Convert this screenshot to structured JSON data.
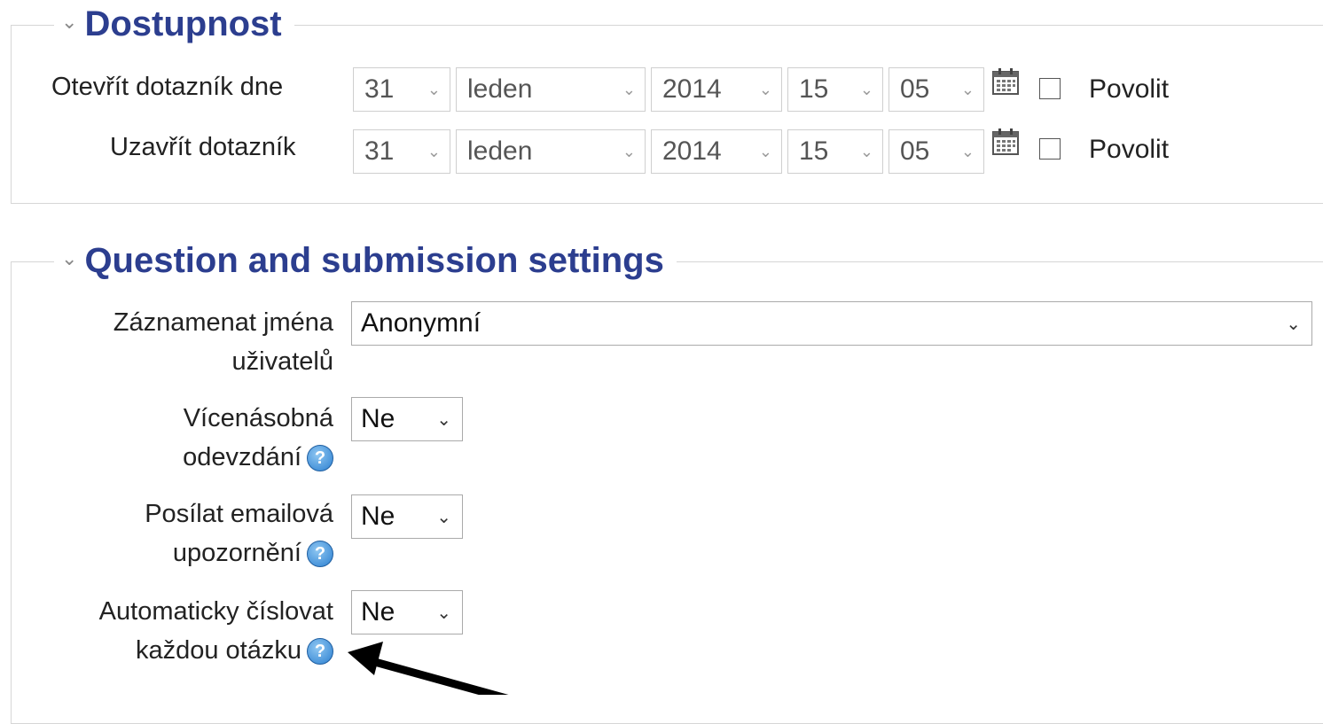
{
  "availability": {
    "title": "Dostupnost",
    "open_label": "Otevřít dotazník dne",
    "close_label": "Uzavřít dotazník",
    "open": {
      "day": "31",
      "month": "leden",
      "year": "2014",
      "hour": "15",
      "minute": "05",
      "enable_label": "Povolit"
    },
    "close": {
      "day": "31",
      "month": "leden",
      "year": "2014",
      "hour": "15",
      "minute": "05",
      "enable_label": "Povolit"
    }
  },
  "settings": {
    "title": "Question and submission settings",
    "record_names": {
      "label_line1": "Záznamenat jména",
      "label_line2": "uživatelů",
      "value": "Anonymní"
    },
    "multiple_submissions": {
      "label_line1": "Vícenásobná",
      "label_line2": "odevzdání",
      "value": "Ne"
    },
    "email_notifications": {
      "label_line1": "Posílat emailová",
      "label_line2": "upozornění",
      "value": "Ne"
    },
    "auto_number": {
      "label_line1": "Automaticky číslovat",
      "label_line2": "každou otázku",
      "value": "Ne"
    }
  },
  "icons": {
    "collapse": "chevron-down-icon",
    "calendar": "calendar-icon",
    "help": "help-icon"
  },
  "colors": {
    "legend_title": "#2c3e8f",
    "help_icon": "#2b7fd0",
    "arrow": "#000000"
  }
}
